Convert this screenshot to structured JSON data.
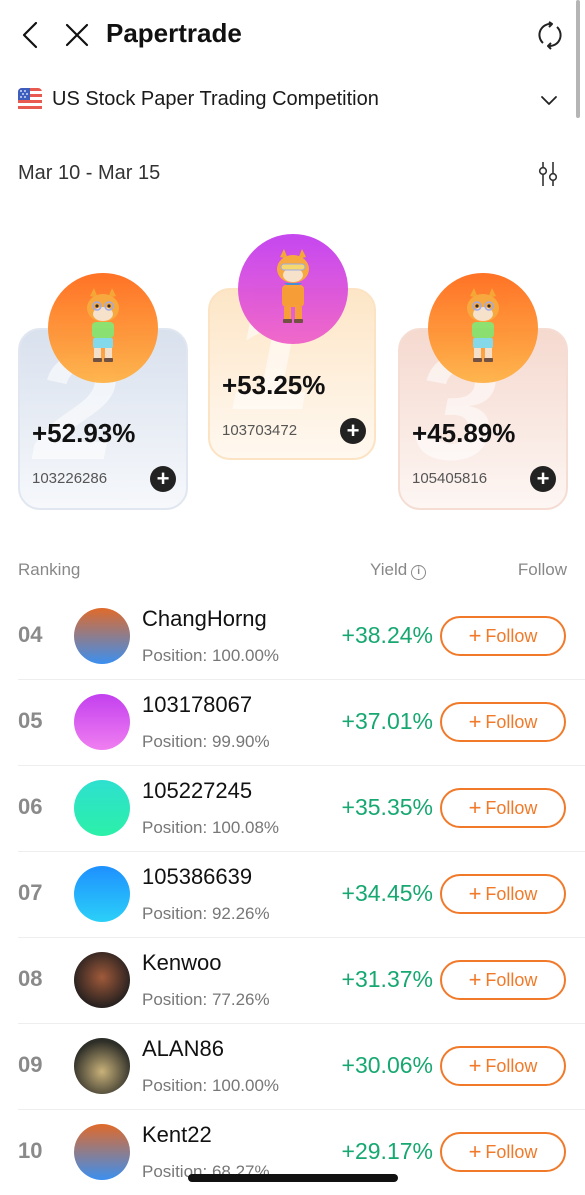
{
  "header": {
    "title": "Papertrade"
  },
  "competition": {
    "label": "US Stock Paper Trading Competition",
    "flag": "us-flag"
  },
  "date_range": "Mar 10 - Mar 15",
  "podium": [
    {
      "rank": "1",
      "yield": "+53.25%",
      "id": "103703472",
      "avatar_color": "#c33ef0"
    },
    {
      "rank": "2",
      "yield": "+52.93%",
      "id": "103226286",
      "avatar_color": "#ff6b1a"
    },
    {
      "rank": "3",
      "yield": "+45.89%",
      "id": "105405816",
      "avatar_color": "#ff6b1a"
    }
  ],
  "list_header": {
    "ranking": "Ranking",
    "yield": "Yield",
    "follow": "Follow"
  },
  "rows": [
    {
      "rank": "04",
      "name": "ChangHorng",
      "position_label": "Position:",
      "position": "100.00%",
      "yield": "+38.24%",
      "follow_label": "Follow",
      "avatar_color": "linear-gradient(180deg,#e06a2a,#3b8ff0)"
    },
    {
      "rank": "05",
      "name": "103178067",
      "position_label": "Position:",
      "position": "99.90%",
      "yield": "+37.01%",
      "follow_label": "Follow",
      "avatar_color": "linear-gradient(180deg,#c340ef,#f07ff0)"
    },
    {
      "rank": "06",
      "name": "105227245",
      "position_label": "Position:",
      "position": "100.08%",
      "yield": "+35.35%",
      "follow_label": "Follow",
      "avatar_color": "linear-gradient(180deg,#2ee0d0,#2bf0a8)"
    },
    {
      "rank": "07",
      "name": "105386639",
      "position_label": "Position:",
      "position": "92.26%",
      "yield": "+34.45%",
      "follow_label": "Follow",
      "avatar_color": "linear-gradient(180deg,#1e90ff,#2bd0f8)"
    },
    {
      "rank": "08",
      "name": "Kenwoo",
      "position_label": "Position:",
      "position": "77.26%",
      "yield": "+31.37%",
      "follow_label": "Follow",
      "avatar_color": "radial-gradient(circle at 50% 45%,#a05a3a,#2a2220 70%)"
    },
    {
      "rank": "09",
      "name": "ALAN86",
      "position_label": "Position:",
      "position": "100.00%",
      "yield": "+30.06%",
      "follow_label": "Follow",
      "avatar_color": "radial-gradient(circle at 50% 60%,#c9b27a,#2e2e28 70%)"
    },
    {
      "rank": "10",
      "name": "Kent22",
      "position_label": "Position:",
      "position": "68.27%",
      "yield": "+29.17%",
      "follow_label": "Follow",
      "avatar_color": "linear-gradient(180deg,#e06a2a,#3b8ff0)"
    }
  ],
  "colors": {
    "accent": "#f07a2a",
    "positive": "#16a870"
  }
}
